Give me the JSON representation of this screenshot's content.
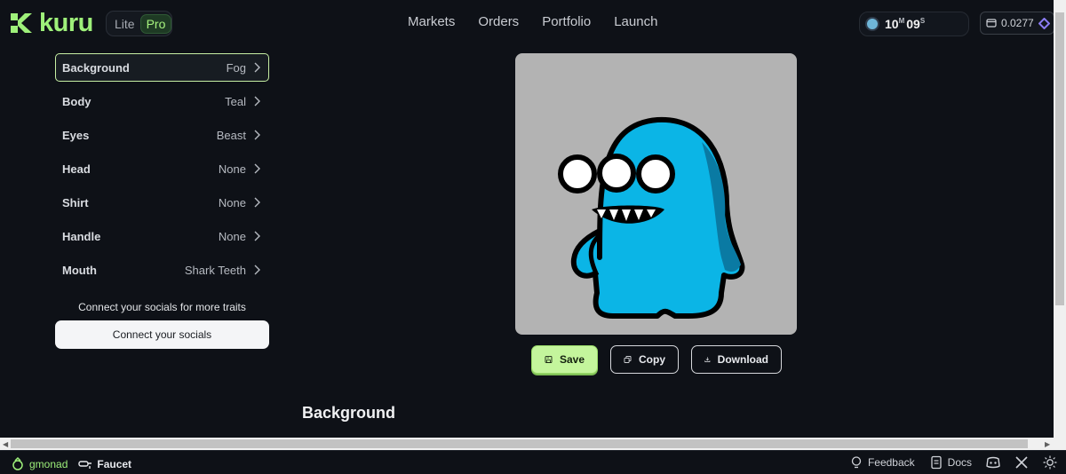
{
  "header": {
    "logo_text": "kuru",
    "mode": {
      "lite": "Lite",
      "pro": "Pro"
    },
    "nav": [
      "Markets",
      "Orders",
      "Portfolio",
      "Launch"
    ],
    "timer": {
      "minutes": "10",
      "minutes_unit": "M",
      "seconds": "09",
      "seconds_unit": "S"
    },
    "balance": "0.0277"
  },
  "traits": [
    {
      "name": "Background",
      "value": "Fog",
      "selected": true
    },
    {
      "name": "Body",
      "value": "Teal"
    },
    {
      "name": "Eyes",
      "value": "Beast"
    },
    {
      "name": "Head",
      "value": "None"
    },
    {
      "name": "Shirt",
      "value": "None"
    },
    {
      "name": "Handle",
      "value": "None"
    },
    {
      "name": "Mouth",
      "value": "Shark Teeth"
    }
  ],
  "socials": {
    "prompt": "Connect your socials for more traits",
    "button": "Connect your socials"
  },
  "actions": {
    "save": "Save",
    "copy": "Copy",
    "download": "Download"
  },
  "section_title": "Background",
  "footer": {
    "gmonad": "gmonad",
    "faucet": "Faucet",
    "feedback": "Feedback",
    "docs": "Docs"
  },
  "colors": {
    "accent": "#9ef07a",
    "preview_bg": "#b3b3b3",
    "body": "#0bb5e6"
  }
}
